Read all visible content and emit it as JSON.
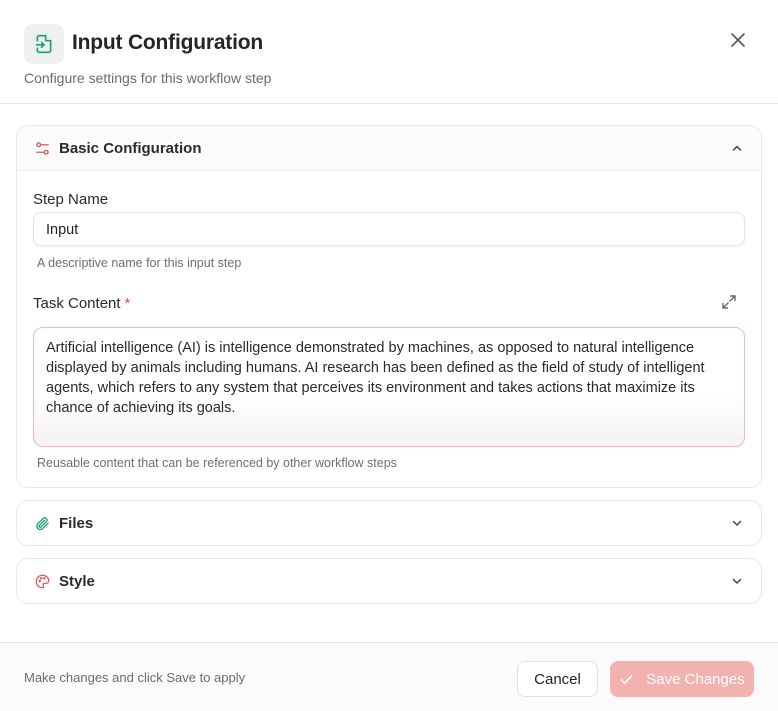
{
  "header": {
    "icon": "file-import-icon",
    "title": "Input Configuration",
    "subtitle": "Configure settings for this workflow step"
  },
  "sections": {
    "basic": {
      "title": "Basic Configuration",
      "icon": "sliders-icon",
      "expanded": true,
      "step_name_label": "Step Name",
      "step_name_value": "Input",
      "step_name_hint": "A descriptive name for this input step",
      "task_content_label": "Task Content",
      "task_content_required": "*",
      "task_content_value": "Artificial intelligence (AI) is intelligence demonstrated by machines, as opposed to natural intelligence displayed by animals including humans. AI research has been defined as the field of study of intelligent agents, which refers to any system that perceives its environment and takes actions that maximize its chance of achieving its goals.",
      "task_content_hint": "Reusable content that can be referenced by other workflow steps"
    },
    "files": {
      "title": "Files",
      "icon": "paperclip-icon",
      "expanded": false
    },
    "style": {
      "title": "Style",
      "icon": "palette-icon",
      "expanded": false
    }
  },
  "footer": {
    "note": "Make changes and click Save to apply",
    "cancel_label": "Cancel",
    "save_label": "Save Changes"
  },
  "colors": {
    "accent_green": "#16a36b",
    "accent_red": "#e0525a",
    "save_button": "#f1b2b0"
  }
}
